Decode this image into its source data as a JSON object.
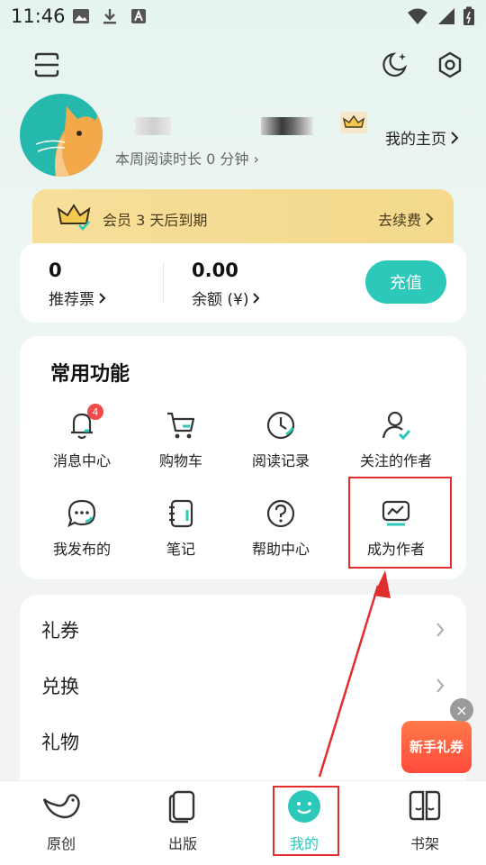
{
  "status_bar": {
    "time": "11:46"
  },
  "profile": {
    "read_time": "本周阅读时长 0 分钟",
    "homepage": "我的主页"
  },
  "vip": {
    "text": "会员 3 天后到期",
    "renew": "去续费"
  },
  "wallet": {
    "tickets_value": "0",
    "tickets_label": "推荐票",
    "balance_value": "0.00",
    "balance_label": "余额 (¥)",
    "recharge": "充值"
  },
  "functions": {
    "title": "常用功能",
    "items": [
      {
        "label": "消息中心",
        "icon": "bell-icon",
        "badge": "4"
      },
      {
        "label": "购物车",
        "icon": "cart-icon"
      },
      {
        "label": "阅读记录",
        "icon": "clock-icon"
      },
      {
        "label": "关注的作者",
        "icon": "person-icon"
      },
      {
        "label": "我发布的",
        "icon": "chat-icon"
      },
      {
        "label": "笔记",
        "icon": "notebook-icon"
      },
      {
        "label": "帮助中心",
        "icon": "help-icon"
      },
      {
        "label": "成为作者",
        "icon": "chart-icon"
      }
    ]
  },
  "list": {
    "items": [
      "礼券",
      "兑换",
      "礼物"
    ]
  },
  "float_coupon": {
    "text": "新手礼券"
  },
  "bottom_nav": {
    "items": [
      "原创",
      "出版",
      "我的",
      "书架"
    ],
    "active_index": 2
  },
  "colors": {
    "accent": "#2cc9ba",
    "vip": "#f6dc94",
    "annotation": "#e02e2e",
    "badge": "#f04a4a"
  }
}
